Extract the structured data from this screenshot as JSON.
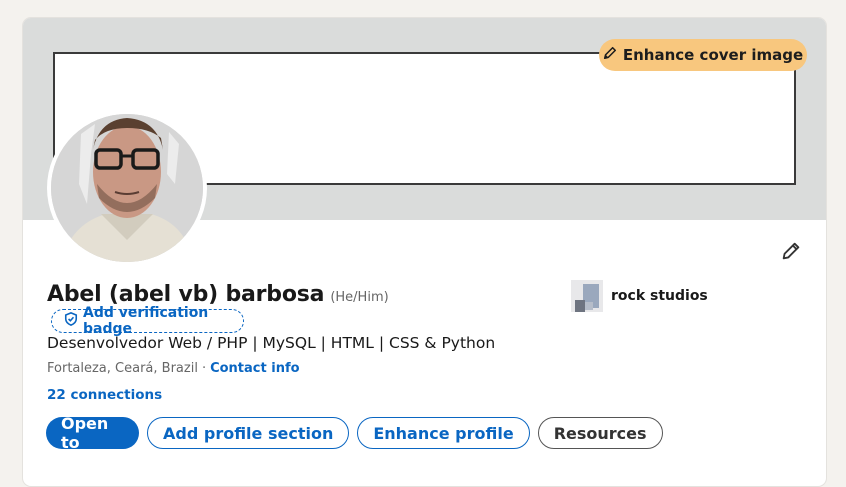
{
  "profile": {
    "name": "Abel (abel vb) barbosa",
    "pronouns": "(He/Him)",
    "verification_label": "Add verification badge",
    "headline": "Desenvolvedor Web / PHP | MySQL | HTML | CSS & Python",
    "location": "Fortaleza, Ceará, Brazil",
    "separator": "·",
    "contact_label": "Contact info",
    "connections": "22 connections"
  },
  "cover": {
    "enhance_label": "Enhance cover image"
  },
  "company": {
    "name": "rock studios"
  },
  "actions": {
    "open_to": "Open to",
    "add_section": "Add profile section",
    "enhance_profile": "Enhance profile",
    "resources": "Resources"
  },
  "colors": {
    "accent": "#0a66c2",
    "cover_button": "#f8c77e",
    "cover_bg": "#dadcdb"
  },
  "icons": {
    "cover_edit": "pencil-icon",
    "profile_edit": "pencil-icon",
    "verify": "shield-check-icon"
  }
}
